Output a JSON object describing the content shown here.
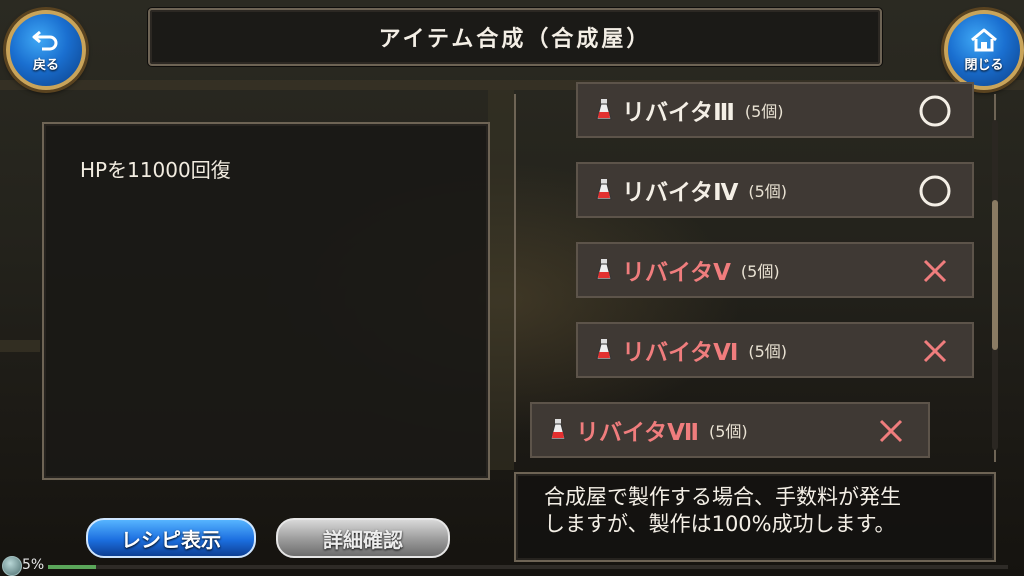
{
  "header": {
    "title": "アイテム合成（合成屋）",
    "back_label": "戻る",
    "close_label": "閉じる"
  },
  "detail": {
    "description": "HPを11000回復"
  },
  "recipes": [
    {
      "name": "リバイタⅢ",
      "qty": "(5個)",
      "status": "craftable",
      "mark": "circle"
    },
    {
      "name": "リバイタⅣ",
      "qty": "(5個)",
      "status": "craftable",
      "mark": "circle"
    },
    {
      "name": "リバイタⅤ",
      "qty": "(5個)",
      "status": "not-craftable",
      "mark": "cross"
    },
    {
      "name": "リバイタⅥ",
      "qty": "(5個)",
      "status": "not-craftable",
      "mark": "cross"
    },
    {
      "name": "リバイタⅦ",
      "qty": "(5個)",
      "status": "not-craftable",
      "mark": "cross",
      "selected": true
    }
  ],
  "message": "合成屋で製作する場合、手数料が発生\nしますが、製作は100%成功します。",
  "buttons": {
    "recipe_label": "レシピ表示",
    "detail_label": "詳細確認"
  },
  "loading": {
    "percent_label": "5%",
    "progress_fraction": 0.05
  },
  "colors": {
    "craftable_text": "#f4efe6",
    "not_craftable_text": "#f07d7d",
    "accent_blue": "#1c6fe0"
  }
}
